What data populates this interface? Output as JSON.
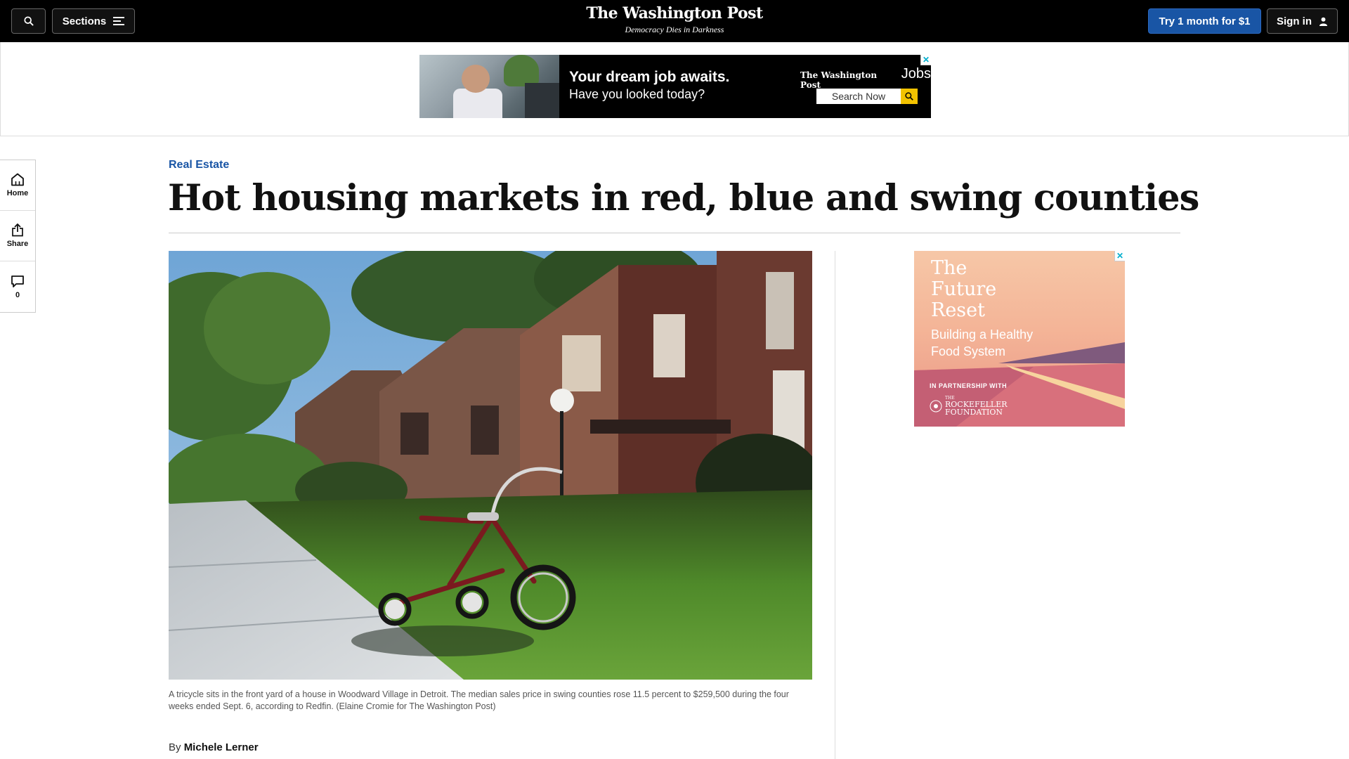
{
  "header": {
    "sections_label": "Sections",
    "logo_name": "The Washington Post",
    "logo_tagline": "Democracy Dies in Darkness",
    "subscribe_label": "Try 1 month for $1",
    "signin_label": "Sign in",
    "icons": [
      "search-icon",
      "menu-icon",
      "user-icon"
    ]
  },
  "top_ad": {
    "headline": "Your dream job awaits.",
    "subline": "Have you looked today?",
    "brand": "The Washington Post",
    "brand_suffix": "Jobs",
    "cta": "Search Now",
    "accent_color": "#f3c300"
  },
  "rail": {
    "home_label": "Home",
    "share_label": "Share",
    "comments_count": "0"
  },
  "article": {
    "kicker": "Real Estate",
    "headline": "Hot housing markets in red, blue and swing counties",
    "caption": "A tricycle sits in the front yard of a house in Woodward Village in Detroit. The median sales price in swing counties rose 11.5 percent to $259,500 during the four weeks ended Sept. 6, according to Redfin. (Elaine Cromie for The Washington Post)",
    "byline_prefix": "By",
    "author": "Michele Lerner",
    "kicker_color": "#1955a5"
  },
  "side_ad": {
    "title_line1": "The",
    "title_line2": "Future",
    "title_line3": "Reset",
    "subtitle_line1": "Building a Healthy",
    "subtitle_line2": "Food System",
    "partner_label": "IN PARTNERSHIP WITH",
    "foundation_prefix": "THE",
    "foundation_line1": "ROCKEFELLER",
    "foundation_line2": "FOUNDATION"
  }
}
